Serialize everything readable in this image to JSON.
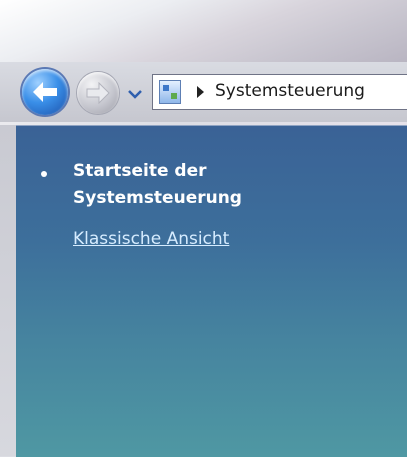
{
  "navigation": {
    "back_button": "back",
    "forward_button": "forward",
    "history_dropdown": "recent-pages"
  },
  "address_bar": {
    "icon": "control-panel-icon",
    "separator": "breadcrumb-arrow-icon",
    "path": "Systemsteuerung"
  },
  "sidebar": {
    "current_item": "Startseite der Systemsteuerung",
    "link": "Klassische Ansicht"
  },
  "colors": {
    "sidebar_top": "#3a6296",
    "sidebar_bottom": "#4f98a3",
    "back_button": "#3a8fe8"
  }
}
